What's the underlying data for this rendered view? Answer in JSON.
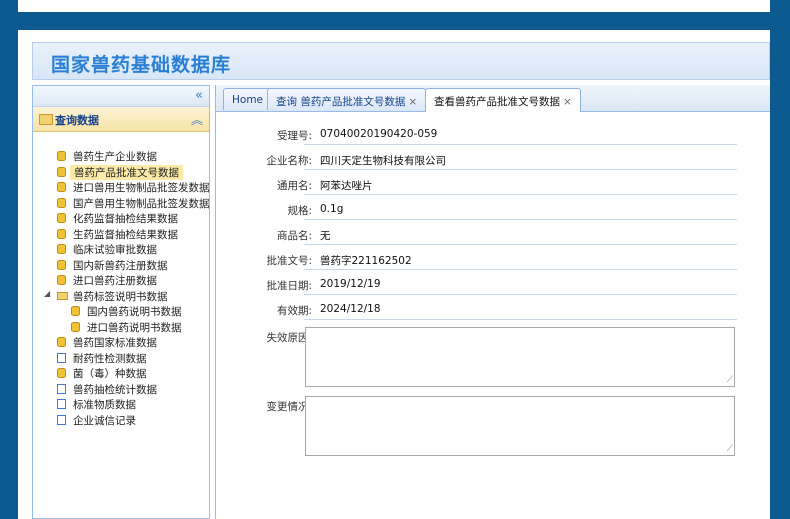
{
  "app": {
    "title": "国家兽药基础数据库"
  },
  "sidebar": {
    "collapse_icon": "«",
    "panel": {
      "title": "查询数据",
      "collapse_icon": "︽"
    },
    "items": [
      {
        "label": "兽药生产企业数据",
        "icon": "database-icon",
        "indent": 0,
        "selected": false
      },
      {
        "label": "兽药产品批准文号数据",
        "icon": "database-icon",
        "indent": 0,
        "selected": true
      },
      {
        "label": "进口兽用生物制品批签发数据",
        "icon": "database-icon",
        "indent": 0,
        "selected": false
      },
      {
        "label": "国产兽用生物制品批签发数据",
        "icon": "database-icon",
        "indent": 0,
        "selected": false
      },
      {
        "label": "化药监督抽检结果数据",
        "icon": "database-icon",
        "indent": 0,
        "selected": false
      },
      {
        "label": "生药监督抽检结果数据",
        "icon": "database-icon",
        "indent": 0,
        "selected": false
      },
      {
        "label": "临床试验审批数据",
        "icon": "database-icon",
        "indent": 0,
        "selected": false
      },
      {
        "label": "国内新兽药注册数据",
        "icon": "database-icon",
        "indent": 0,
        "selected": false
      },
      {
        "label": "进口兽药注册数据",
        "icon": "database-icon",
        "indent": 0,
        "selected": false
      },
      {
        "label": "兽药标签说明书数据",
        "icon": "folder-icon",
        "indent": 0,
        "selected": false,
        "expanded": true
      },
      {
        "label": "国内兽药说明书数据",
        "icon": "database-icon",
        "indent": 1,
        "selected": false
      },
      {
        "label": "进口兽药说明书数据",
        "icon": "database-icon",
        "indent": 1,
        "selected": false
      },
      {
        "label": "兽药国家标准数据",
        "icon": "database-icon",
        "indent": 0,
        "selected": false
      },
      {
        "label": "耐药性检测数据",
        "icon": "document-icon",
        "indent": 0,
        "selected": false
      },
      {
        "label": "菌（毒）种数据",
        "icon": "database-icon",
        "indent": 0,
        "selected": false
      },
      {
        "label": "兽药抽检统计数据",
        "icon": "document-icon",
        "indent": 0,
        "selected": false
      },
      {
        "label": "标准物质数据",
        "icon": "document-icon",
        "indent": 0,
        "selected": false
      },
      {
        "label": "企业诚信记录",
        "icon": "document-icon",
        "indent": 0,
        "selected": false
      }
    ]
  },
  "tabs": [
    {
      "label": "Home",
      "closable": false,
      "active": false
    },
    {
      "label": "查询 兽药产品批准文号数据",
      "closable": true,
      "active": false
    },
    {
      "label": "查看兽药产品批准文号数据",
      "closable": true,
      "active": true
    }
  ],
  "form": {
    "fields": [
      {
        "label": "受理号:",
        "value": "07040020190420-059"
      },
      {
        "label": "企业名称:",
        "value": "四川天定生物科技有限公司"
      },
      {
        "label": "通用名:",
        "value": "阿苯达唑片"
      },
      {
        "label": "规格:",
        "value": "0.1g"
      },
      {
        "label": "商品名:",
        "value": "无"
      },
      {
        "label": "批准文号:",
        "value": "兽药字221162502"
      },
      {
        "label": "批准日期:",
        "value": "2019/12/19"
      },
      {
        "label": "有效期:",
        "value": "2024/12/18"
      }
    ],
    "textareas": [
      {
        "label": "失效原因:",
        "value": ""
      },
      {
        "label": "变更情况:",
        "value": ""
      }
    ]
  },
  "colors": {
    "background": "#0d5a90",
    "accent": "#2a7fd4",
    "selected": "#fbe9a7"
  }
}
